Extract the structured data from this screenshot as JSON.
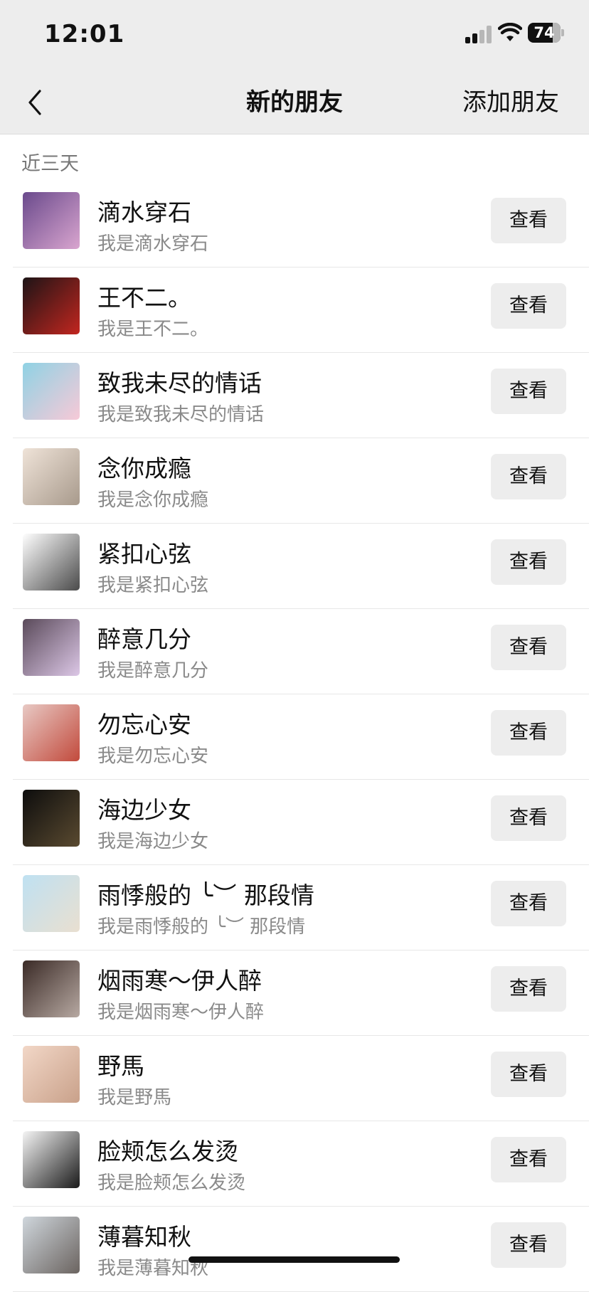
{
  "status_bar": {
    "time": "12:01",
    "battery": "74",
    "signal_icon": "signal-icon",
    "wifi_icon": "wifi-icon"
  },
  "nav": {
    "back_icon": "chevron-left-icon",
    "title": "新的朋友",
    "add_label": "添加朋友"
  },
  "section_label": "近三天",
  "view_label": "查看",
  "friends": [
    {
      "name": "滴水穿石",
      "sub": "我是滴水穿石",
      "avatar": "anime-girl-purple-avatar",
      "colors": [
        "#6a4a8c",
        "#d9a5cf"
      ]
    },
    {
      "name": "王不二。",
      "sub": "我是王不二。",
      "avatar": "red-costume-avatar",
      "colors": [
        "#1d1416",
        "#c2261f"
      ]
    },
    {
      "name": "致我未尽的情话",
      "sub": "我是致我未尽的情话",
      "avatar": "bunny-cartoon-avatar",
      "colors": [
        "#8fd2e4",
        "#f7c9d7"
      ]
    },
    {
      "name": "念你成瘾",
      "sub": "我是念你成瘾",
      "avatar": "puppy-avatar",
      "colors": [
        "#efe3d8",
        "#a89a8c"
      ]
    },
    {
      "name": "紧扣心弦",
      "sub": "我是紧扣心弦",
      "avatar": "cartoon-family-avatar",
      "colors": [
        "#ffffff",
        "#4a4a4a"
      ]
    },
    {
      "name": "醉意几分",
      "sub": "我是醉意几分",
      "avatar": "anime-girl-dark-hair-avatar",
      "colors": [
        "#5a4a5a",
        "#dcc7e6"
      ]
    },
    {
      "name": "勿忘心安",
      "sub": "我是勿忘心安",
      "avatar": "ancient-style-girl-avatar",
      "colors": [
        "#e8c9c4",
        "#c24a3c"
      ]
    },
    {
      "name": "海边少女",
      "sub": "我是海边少女",
      "avatar": "dark-photo-avatar",
      "colors": [
        "#0d0d0d",
        "#5a4a30"
      ]
    },
    {
      "name": "雨悸般的  ╰︶ 那段情",
      "sub": "我是雨悸般的  ╰︶ 那段情",
      "avatar": "beach-avatar",
      "colors": [
        "#bfe1f2",
        "#e9dfd0"
      ]
    },
    {
      "name": "烟雨寒～伊人醉",
      "sub": "我是烟雨寒～伊人醉",
      "avatar": "child-photo-avatar",
      "colors": [
        "#3a2a26",
        "#b7a9a2"
      ]
    },
    {
      "name": "野馬",
      "sub": "我是野馬",
      "avatar": "baby-photo-avatar",
      "colors": [
        "#f2d7c7",
        "#c9a18a"
      ]
    },
    {
      "name": "脸颊怎么发烫",
      "sub": "我是脸颊怎么发烫",
      "avatar": "sketch-girl-avatar",
      "colors": [
        "#f5f5f5",
        "#1a1a1a"
      ]
    },
    {
      "name": "薄暮知秋",
      "sub": "我是薄暮知秋",
      "avatar": "beach-girl-avatar",
      "colors": [
        "#cfd6dc",
        "#6b6460"
      ]
    }
  ]
}
